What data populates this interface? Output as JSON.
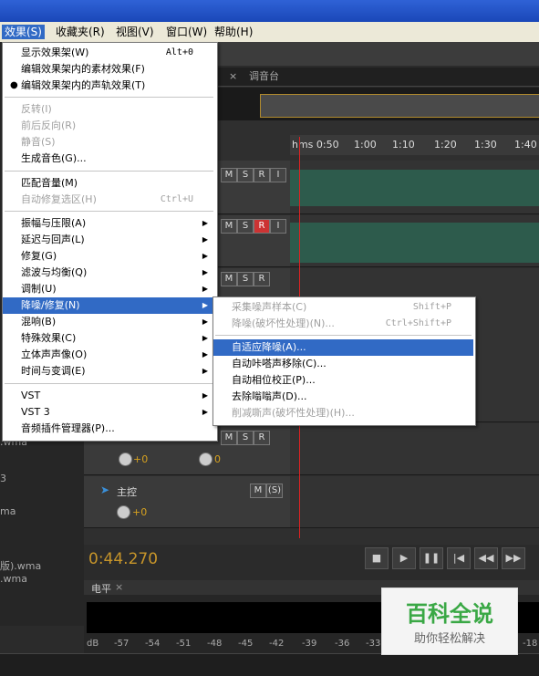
{
  "menubar": {
    "items": [
      "效果(S)",
      "收藏夹(R)",
      "视图(V)",
      "窗口(W)",
      "帮助(H)"
    ]
  },
  "effects_menu": {
    "items": [
      {
        "label": "显示效果架(W)",
        "shortcut": "Alt+0"
      },
      {
        "label": "编辑效果架内的素材效果(F)"
      },
      {
        "label": "编辑效果架内的声轨效果(T)",
        "checked": true
      },
      {
        "label": "反转(I)",
        "disabled": true
      },
      {
        "label": "前后反向(R)",
        "disabled": true
      },
      {
        "label": "静音(S)",
        "disabled": true
      },
      {
        "label": "生成音色(G)..."
      },
      {
        "label": "匹配音量(M)"
      },
      {
        "label": "自动修复选区(H)",
        "shortcut": "Ctrl+U",
        "disabled": true
      },
      {
        "label": "振幅与压限(A)",
        "submenu": true
      },
      {
        "label": "延迟与回声(L)",
        "submenu": true
      },
      {
        "label": "修复(G)",
        "submenu": true
      },
      {
        "label": "滤波与均衡(Q)",
        "submenu": true
      },
      {
        "label": "调制(U)",
        "submenu": true
      },
      {
        "label": "降噪/修复(N)",
        "submenu": true,
        "highlighted": true
      },
      {
        "label": "混响(B)",
        "submenu": true
      },
      {
        "label": "特殊效果(C)",
        "submenu": true
      },
      {
        "label": "立体声声像(O)",
        "submenu": true
      },
      {
        "label": "时间与变调(E)",
        "submenu": true
      },
      {
        "label": "VST",
        "submenu": true
      },
      {
        "label": "VST 3",
        "submenu": true
      },
      {
        "label": "音频插件管理器(P)..."
      }
    ]
  },
  "noise_submenu": {
    "items": [
      {
        "label": "采集噪声样本(C)",
        "shortcut": "Shift+P",
        "disabled": true
      },
      {
        "label": "降噪(破坏性处理)(N)...",
        "shortcut": "Ctrl+Shift+P",
        "disabled": true
      },
      {
        "label": "自适应降噪(A)...",
        "highlighted": true
      },
      {
        "label": "自动咔嗒声移除(C)..."
      },
      {
        "label": "自动相位校正(P)..."
      },
      {
        "label": "去除嗡嗡声(D)..."
      },
      {
        "label": "削减嘶声(破坏性处理)(H)...",
        "disabled": true
      }
    ]
  },
  "tabs": {
    "close": "×",
    "mixer": "调音台"
  },
  "ruler": {
    "labels": [
      "hms 0:50",
      "1:00",
      "1:10",
      "1:20",
      "1:30",
      "1:40"
    ]
  },
  "tracks": {
    "m": "M",
    "s": "S",
    "r": "R",
    "i": "I",
    "gain_value": "0",
    "gain_plus": "+0",
    "master_label": "主控",
    "master_m": "M",
    "master_s": "(S)"
  },
  "timecode": "0:44.270",
  "transport": {
    "stop": "■",
    "play": "▶",
    "pause": "❚❚",
    "to_start": "|◀",
    "rewind": "◀◀",
    "forward": "▶▶",
    "to_end": "▶|"
  },
  "level_panel": {
    "title": "电平",
    "close": "×",
    "db_labels": [
      "dB",
      "-57",
      "-54",
      "-51",
      "-48",
      "-45",
      "-42",
      "-39",
      "-36",
      "-33",
      "-18"
    ]
  },
  "file_panel": {
    "names": [
      ".wma",
      "3",
      "ma",
      "版).wma",
      ".wma"
    ]
  },
  "watermark": {
    "title": "百科全说",
    "subtitle": "助你轻松解决"
  },
  "colors": {
    "accent": "#316ac5",
    "timecode": "#c7952a",
    "playhead": "#dd2222",
    "wave": "#5fae93"
  }
}
